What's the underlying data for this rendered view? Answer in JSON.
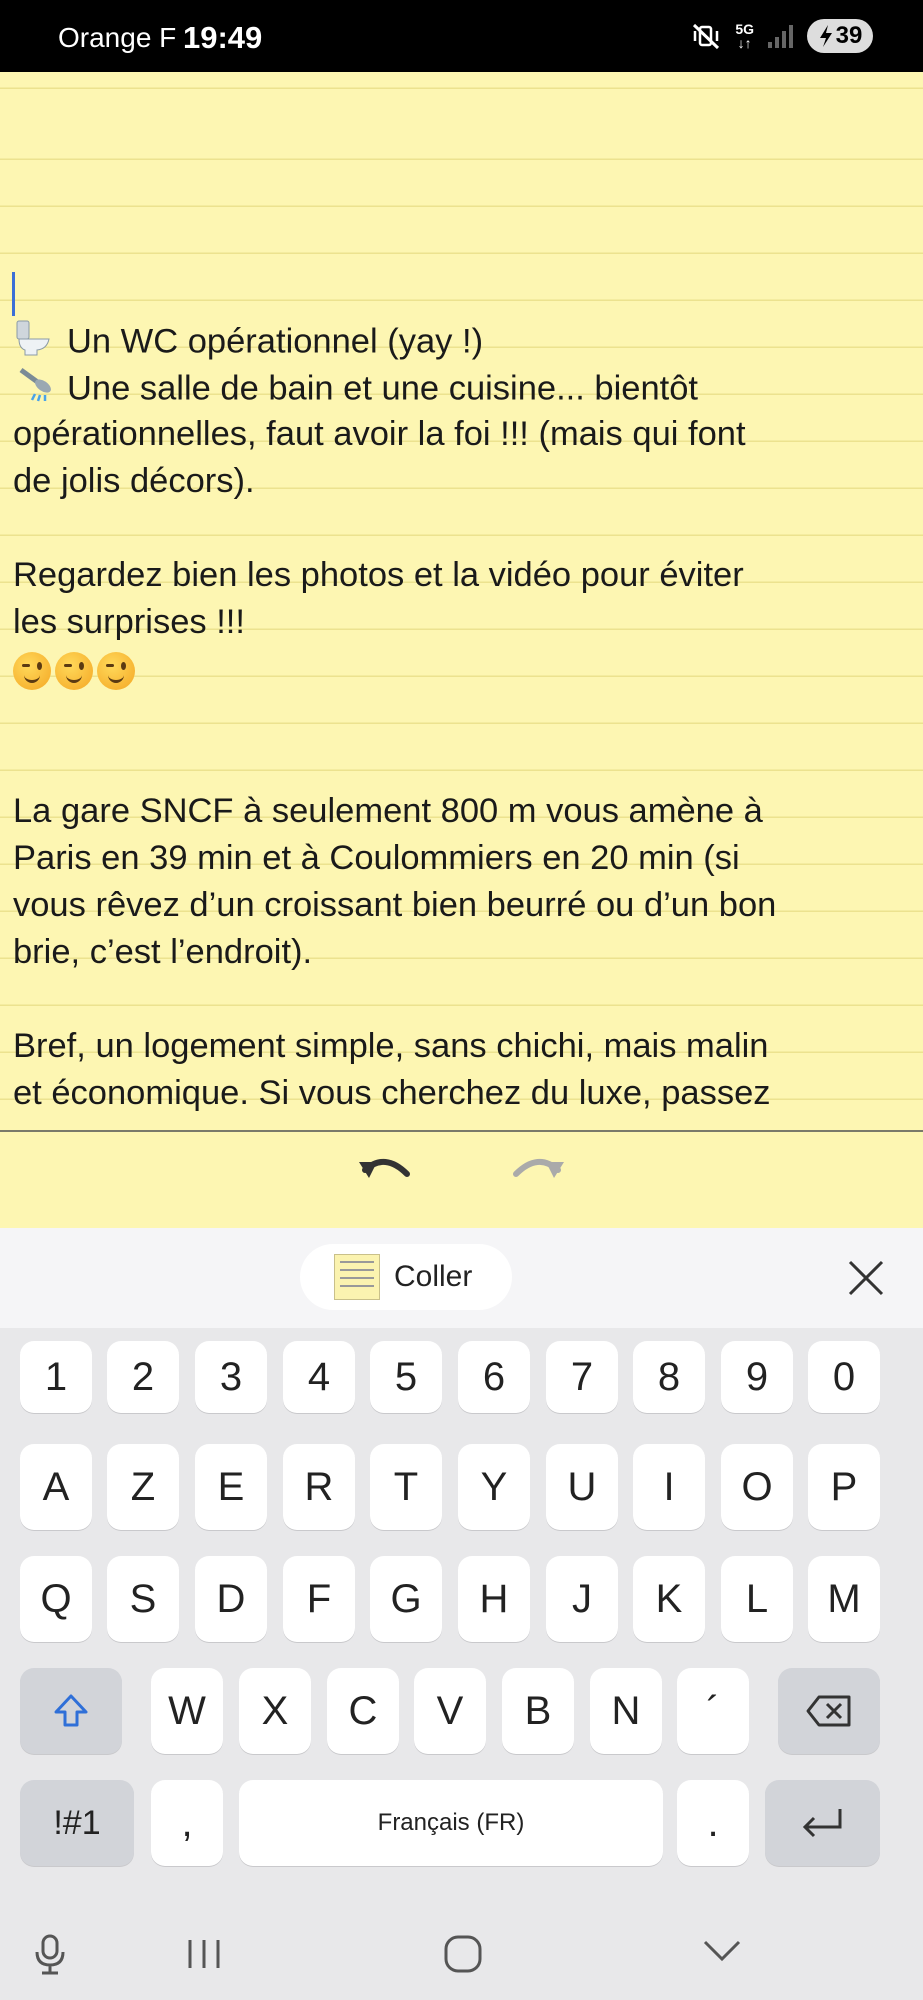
{
  "status_bar": {
    "carrier": "Orange F",
    "time": "19:49",
    "network": "5G",
    "battery": "39",
    "icons": [
      "mute-vibrate-icon",
      "signal-icon",
      "battery-charging-icon"
    ]
  },
  "note": {
    "lines": [
      {
        "icon": "toilet-emoji",
        "text": "Un WC opérationnel (yay !)"
      },
      {
        "icon": "shower-emoji",
        "text": "Une salle de bain et une cuisine... bientôt"
      },
      {
        "text": "opérationnelles, faut avoir la foi !!! (mais qui font"
      },
      {
        "text": "de jolis décors)."
      },
      {
        "text": "Regardez bien les photos et la vidéo pour éviter"
      },
      {
        "text": "les surprises !!!"
      },
      {
        "emojis": [
          "winking-face-emoji",
          "winking-face-emoji",
          "winking-face-emoji"
        ]
      },
      {
        "text": "La gare SNCF à seulement 800 m vous amène à"
      },
      {
        "text": "Paris en 39 min et à Coulommiers en 20 min (si"
      },
      {
        "text": "vous rêvez d’un croissant bien beurré ou d’un bon"
      },
      {
        "text": "brie, c’est l’endroit)."
      },
      {
        "text": "Bref, un logement simple, sans chichi, mais malin"
      },
      {
        "text": "et économique. Si vous cherchez du luxe, passez"
      }
    ]
  },
  "toolbar": {
    "undo_icon": "undo-icon",
    "redo_icon": "redo-icon"
  },
  "keyboard": {
    "paste_label": "Coller",
    "number_row": [
      "1",
      "2",
      "3",
      "4",
      "5",
      "6",
      "7",
      "8",
      "9",
      "0"
    ],
    "row1": [
      "A",
      "Z",
      "E",
      "R",
      "T",
      "Y",
      "U",
      "I",
      "O",
      "P"
    ],
    "row2": [
      "Q",
      "S",
      "D",
      "F",
      "G",
      "H",
      "J",
      "K",
      "L",
      "M"
    ],
    "row3": [
      "W",
      "X",
      "C",
      "V",
      "B",
      "N",
      "´"
    ],
    "symbols_key": "!#1",
    "comma_key": ",",
    "space_label": "Français (FR)",
    "period_key": "."
  },
  "colors": {
    "note_bg": "#fdf6b2",
    "rule_line": "#ece28f",
    "cursor": "#3b6fd6",
    "keyboard_bg": "#e8e8ea"
  }
}
